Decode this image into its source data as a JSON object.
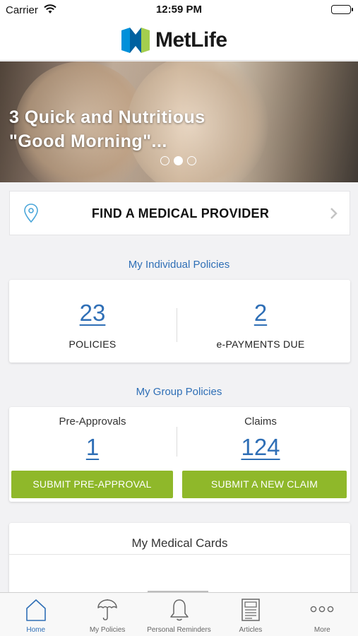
{
  "status_bar": {
    "carrier": "Carrier",
    "time": "12:59 PM"
  },
  "header": {
    "brand": "MetLife",
    "brand_colors": [
      "#0090da",
      "#a4ce4e"
    ]
  },
  "hero": {
    "title": "3 Quick and Nutritious \"Good Morning\"...",
    "slides": 3,
    "active_slide": 2
  },
  "find_provider": {
    "label": "FIND A MEDICAL PROVIDER"
  },
  "individual": {
    "title": "My Individual Policies",
    "policies_count": "23",
    "policies_label": "POLICIES",
    "payments_count": "2",
    "payments_label": "e-PAYMENTS DUE"
  },
  "group": {
    "title": "My Group Policies",
    "preapprovals_label": "Pre-Approvals",
    "preapprovals_count": "1",
    "claims_label": "Claims",
    "claims_count": "124",
    "submit_preapproval": "SUBMIT PRE-APPROVAL",
    "submit_claim": "SUBMIT A NEW CLAIM"
  },
  "medical_cards": {
    "title": "My Medical Cards"
  },
  "tabs": [
    {
      "label": "Home",
      "icon": "home-icon"
    },
    {
      "label": "My Policies",
      "icon": "umbrella-icon"
    },
    {
      "label": "Personal Reminders",
      "icon": "bell-icon"
    },
    {
      "label": "Articles",
      "icon": "article-icon"
    },
    {
      "label": "More",
      "icon": "more-icon"
    }
  ],
  "colors": {
    "accent_blue": "#2f6fb6",
    "button_green": "#8fb82a"
  }
}
